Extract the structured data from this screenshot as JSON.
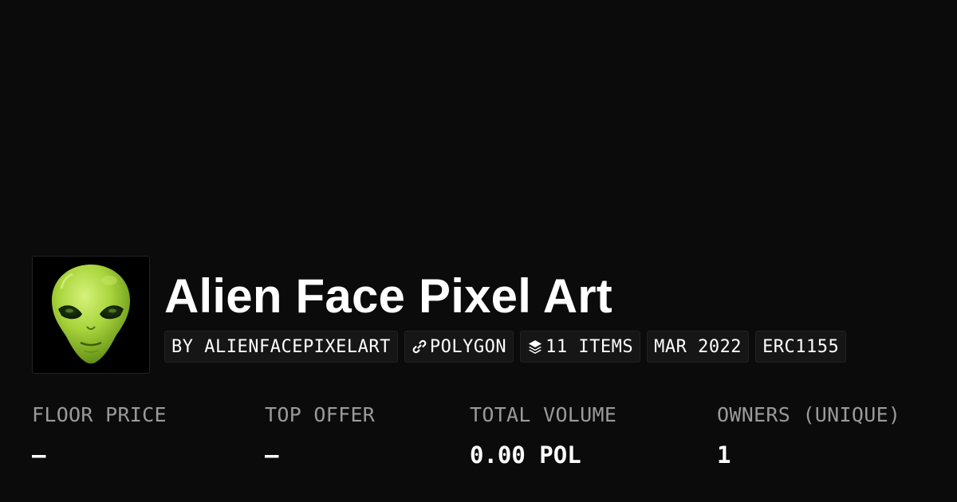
{
  "collection": {
    "title": "Alien Face Pixel Art",
    "image_icon": "alien-face-icon"
  },
  "tags": {
    "creator": "BY ALIENFACEPIXELART",
    "chain": "POLYGON",
    "chain_icon": "chain-link-icon",
    "items": "11 ITEMS",
    "items_icon": "layers-icon",
    "date": "MAR 2022",
    "standard": "ERC1155"
  },
  "stats": {
    "floor_price": {
      "label": "FLOOR PRICE",
      "value": "–"
    },
    "top_offer": {
      "label": "TOP OFFER",
      "value": "–"
    },
    "total_volume": {
      "label": "TOTAL VOLUME",
      "value": "0.00 POL"
    },
    "owners": {
      "label": "OWNERS (UNIQUE)",
      "value": "1"
    }
  },
  "colors": {
    "background": "#0b0b0b",
    "text": "#ffffff",
    "muted": "#9a9a9a",
    "alien_green": "#a6d43a"
  }
}
